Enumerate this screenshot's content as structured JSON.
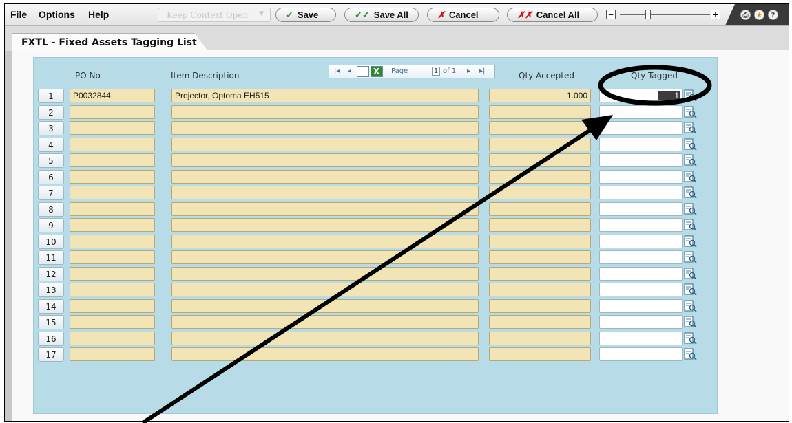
{
  "menu": {
    "file": "File",
    "options": "Options",
    "help": "Help"
  },
  "toolbar": {
    "keep_context": "Keep Context Open",
    "save": "Save",
    "save_all": "Save All",
    "cancel": "Cancel",
    "cancel_all": "Cancel All",
    "zoom_minus": "−",
    "zoom_plus": "+"
  },
  "tab": {
    "title": "FXTL - Fixed Assets Tagging List"
  },
  "grid": {
    "columns": {
      "po_no": "PO No",
      "item_description": "Item Description",
      "qty_accepted": "Qty Accepted",
      "qty_tagged": "Qty Tagged"
    },
    "pager": {
      "label": "Page",
      "current": "1",
      "of": "of 1"
    },
    "rows": [
      {
        "n": "1",
        "po_no": "P0032844",
        "desc": "Projector, Optoma EH515",
        "qty": "1.000",
        "tagged": "1"
      },
      {
        "n": "2",
        "po_no": "",
        "desc": "",
        "qty": "",
        "tagged": ""
      },
      {
        "n": "3",
        "po_no": "",
        "desc": "",
        "qty": "",
        "tagged": ""
      },
      {
        "n": "4",
        "po_no": "",
        "desc": "",
        "qty": "",
        "tagged": ""
      },
      {
        "n": "5",
        "po_no": "",
        "desc": "",
        "qty": "",
        "tagged": ""
      },
      {
        "n": "6",
        "po_no": "",
        "desc": "",
        "qty": "",
        "tagged": ""
      },
      {
        "n": "7",
        "po_no": "",
        "desc": "",
        "qty": "",
        "tagged": ""
      },
      {
        "n": "8",
        "po_no": "",
        "desc": "",
        "qty": "",
        "tagged": ""
      },
      {
        "n": "9",
        "po_no": "",
        "desc": "",
        "qty": "",
        "tagged": ""
      },
      {
        "n": "10",
        "po_no": "",
        "desc": "",
        "qty": "",
        "tagged": ""
      },
      {
        "n": "11",
        "po_no": "",
        "desc": "",
        "qty": "",
        "tagged": ""
      },
      {
        "n": "12",
        "po_no": "",
        "desc": "",
        "qty": "",
        "tagged": ""
      },
      {
        "n": "13",
        "po_no": "",
        "desc": "",
        "qty": "",
        "tagged": ""
      },
      {
        "n": "14",
        "po_no": "",
        "desc": "",
        "qty": "",
        "tagged": ""
      },
      {
        "n": "15",
        "po_no": "",
        "desc": "",
        "qty": "",
        "tagged": ""
      },
      {
        "n": "16",
        "po_no": "",
        "desc": "",
        "qty": "",
        "tagged": ""
      },
      {
        "n": "17",
        "po_no": "",
        "desc": "",
        "qty": "",
        "tagged": ""
      }
    ]
  },
  "colors": {
    "grid_bg": "#b8dbe8",
    "field_bg": "#f2e4b4",
    "annotation": "#000000"
  }
}
